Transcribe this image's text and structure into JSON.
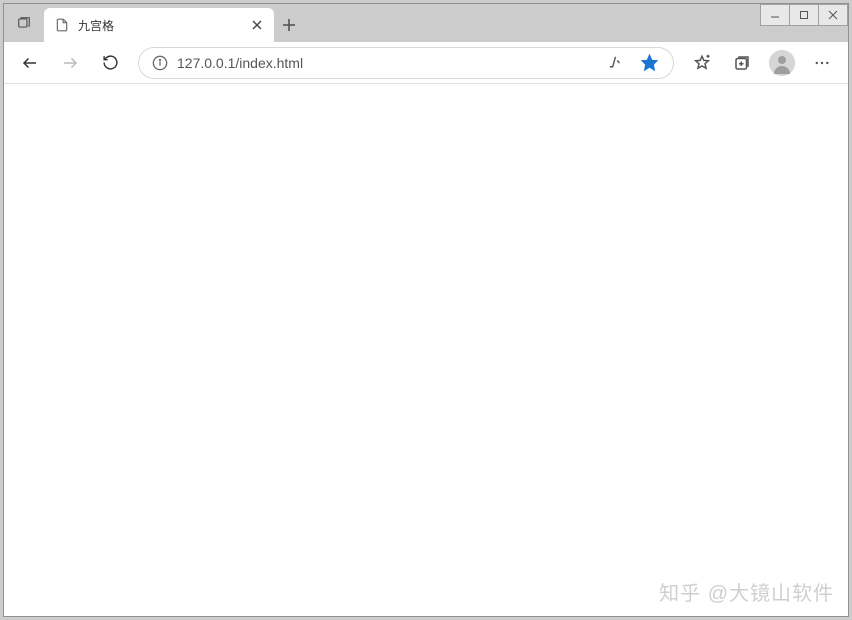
{
  "tab": {
    "title": "九宫格"
  },
  "address": {
    "url": "127.0.0.1/index.html"
  },
  "watermark": "知乎 @大镜山软件"
}
